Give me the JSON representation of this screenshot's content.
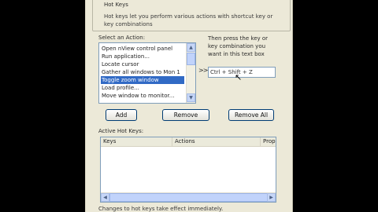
{
  "hotkeys_group": {
    "title": "Hot Keys",
    "description": "Hot keys let you perform various actions with shortcut key or key combinations"
  },
  "select_action": {
    "label": "Select an Action:",
    "items": [
      {
        "label": "Open nView control panel",
        "selected": false
      },
      {
        "label": "Run application...",
        "selected": false
      },
      {
        "label": "Locate cursor",
        "selected": false
      },
      {
        "label": "Gather all windows to Mon 1",
        "selected": false
      },
      {
        "label": "Toggle zoom window",
        "selected": true
      },
      {
        "label": "Load profile...",
        "selected": false
      },
      {
        "label": "Move window to monitor...",
        "selected": false
      }
    ]
  },
  "key_entry": {
    "instruction": "Then press the key or key combination you want in this text box",
    "arrows": ">>",
    "value": "Ctrl + Shift + Z"
  },
  "buttons": {
    "add": "Add",
    "remove": "Remove",
    "remove_all": "Remove All"
  },
  "active_hotkeys": {
    "label": "Active Hot Keys:",
    "columns": [
      "Keys",
      "Actions",
      "Prop"
    ]
  },
  "footer": "Changes to hot keys take effect immediately.",
  "colors": {
    "window_bg": "#ece9d8",
    "selection": "#316ac5",
    "border": "#7f9db9"
  }
}
